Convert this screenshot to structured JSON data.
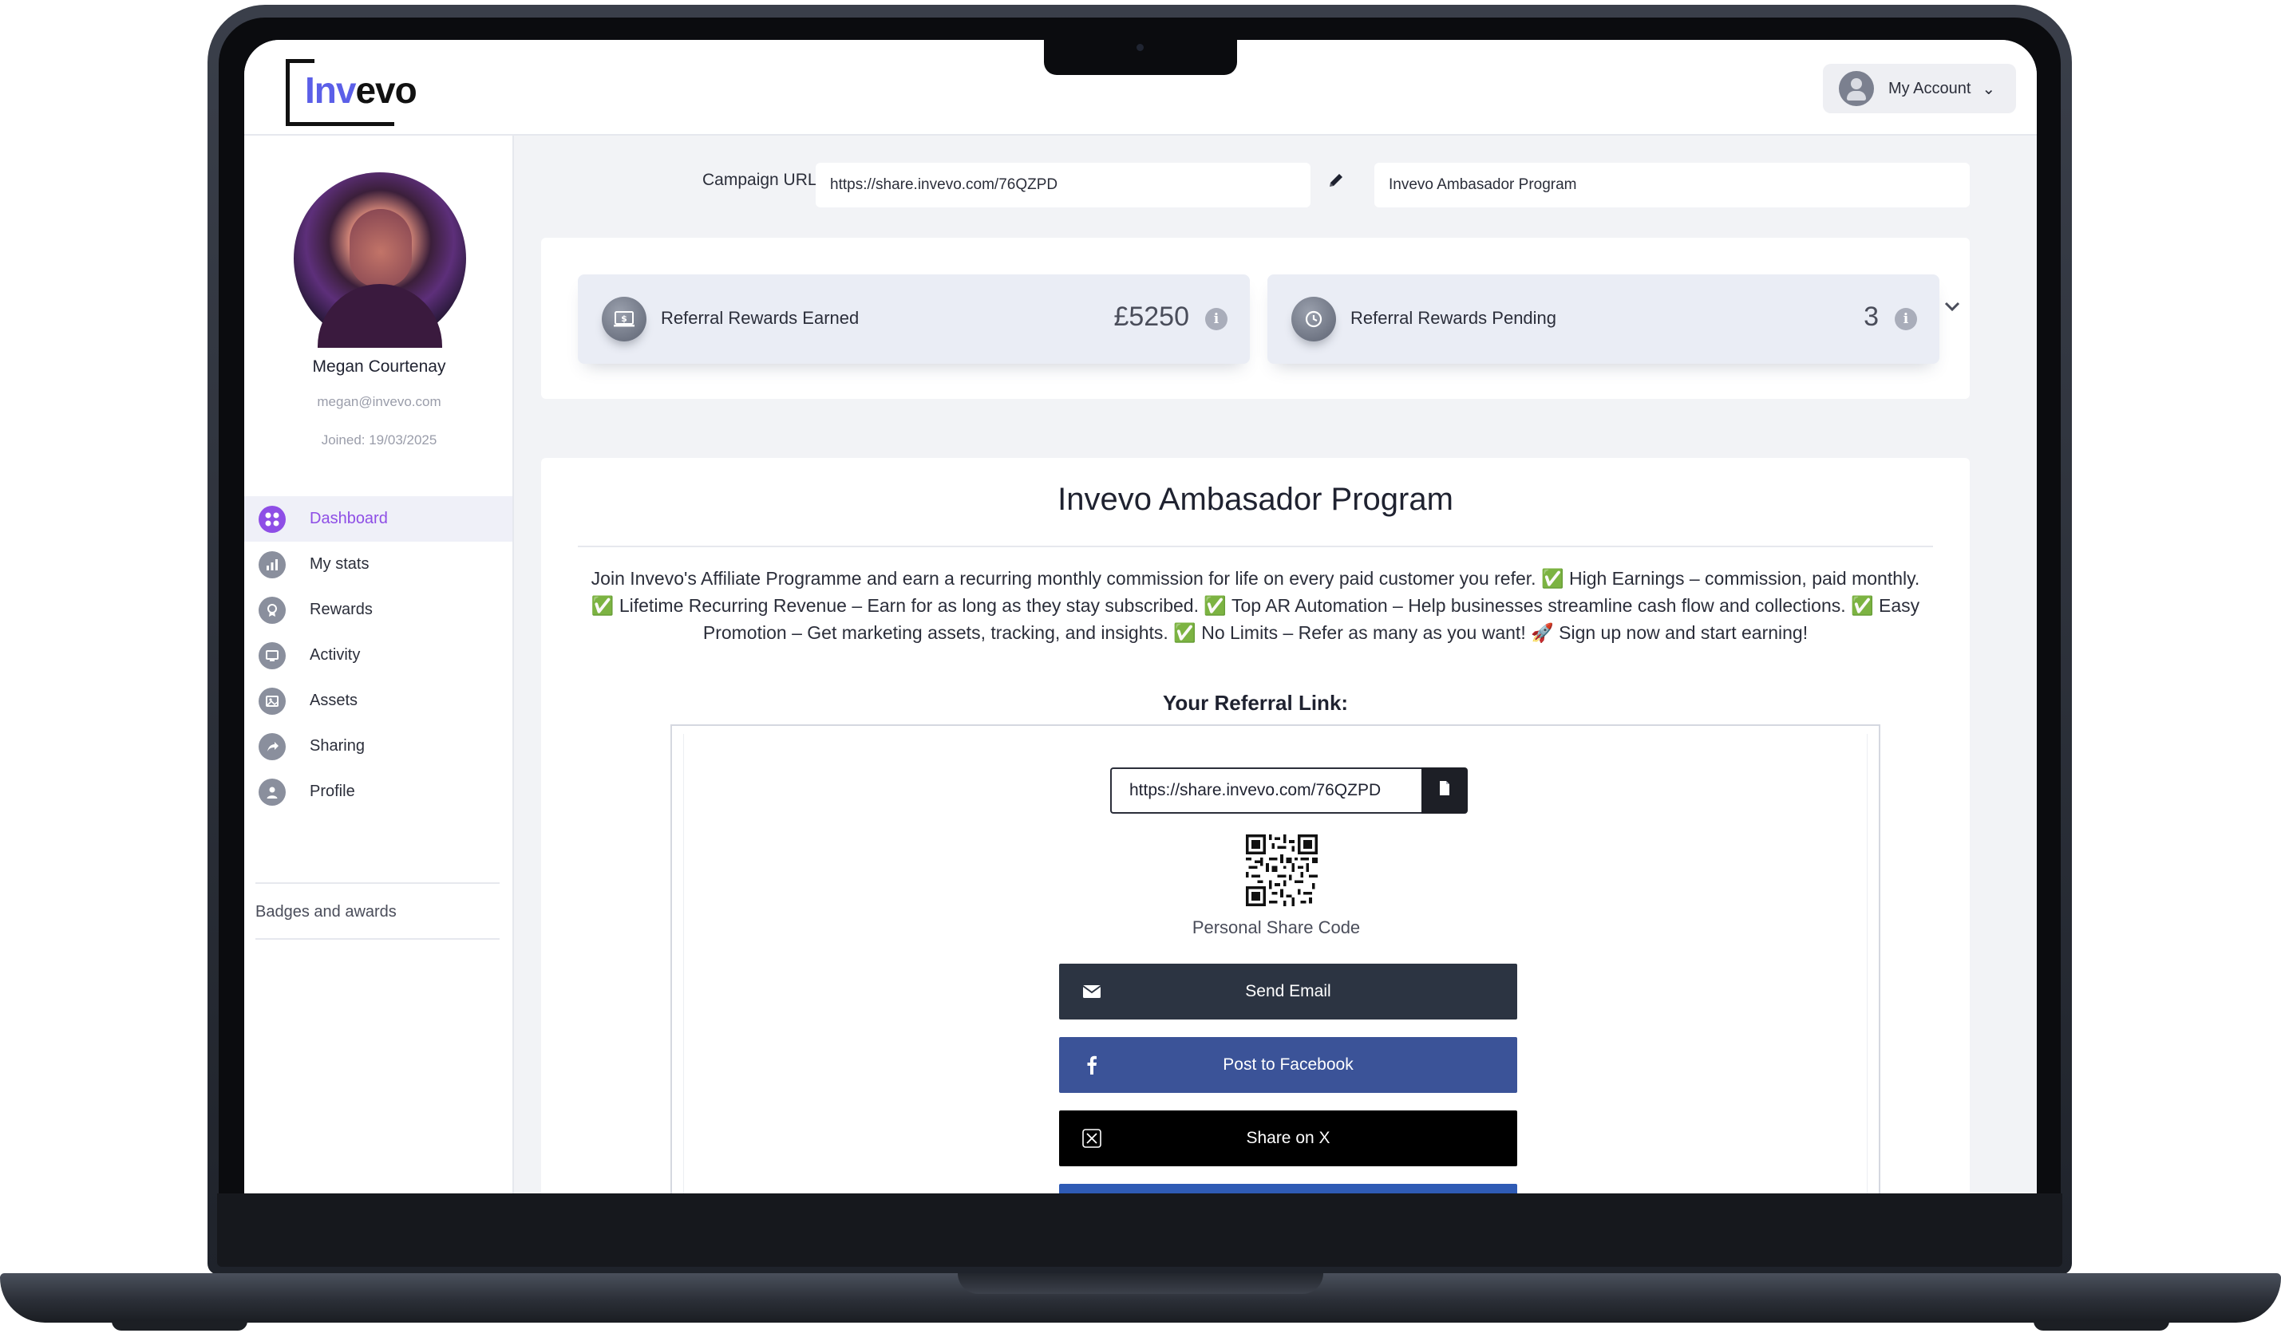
{
  "app": {
    "logo_text_accent": "Inv",
    "logo_text_rest": "evo",
    "account_label": "My Account"
  },
  "profile": {
    "name": "Megan Courtenay",
    "email": "megan@invevo.com",
    "joined": "Joined: 19/03/2025"
  },
  "nav": {
    "items": [
      {
        "label": "Dashboard",
        "icon": "grid-icon",
        "active": true
      },
      {
        "label": "My stats",
        "icon": "chart-icon",
        "active": false
      },
      {
        "label": "Rewards",
        "icon": "award-icon",
        "active": false
      },
      {
        "label": "Activity",
        "icon": "monitor-icon",
        "active": false
      },
      {
        "label": "Assets",
        "icon": "image-icon",
        "active": false
      },
      {
        "label": "Sharing",
        "icon": "share-icon",
        "active": false
      },
      {
        "label": "Profile",
        "icon": "user-icon",
        "active": false
      }
    ],
    "badges_label": "Badges and awards"
  },
  "campaign": {
    "url_label": "Campaign URL",
    "url_value": "https://share.invevo.com/76QZPD",
    "name_value": "Invevo Ambasador Program"
  },
  "stats": {
    "earned_label": "Referral Rewards Earned",
    "earned_value": "£5250",
    "pending_label": "Referral Rewards Pending",
    "pending_value": "3"
  },
  "program": {
    "title": "Invevo Ambasador Program",
    "description": "Join Invevo's Affiliate Programme and earn a recurring monthly commission for life on every paid customer you refer. ✅ High Earnings – commission, paid monthly. ✅ Lifetime Recurring Revenue – Earn for as long as they stay subscribed. ✅ Top AR Automation – Help businesses streamline cash flow and collections. ✅ Easy Promotion – Get marketing assets, tracking, and insights. ✅ No Limits – Refer as many as you want! 🚀 Sign up now and start earning!",
    "referral_title": "Your Referral Link:",
    "referral_link": "https://share.invevo.com/76QZPD",
    "qr_label": "Personal Share Code",
    "buttons": {
      "email": "Send Email",
      "facebook": "Post to Facebook",
      "x": "Share on X"
    }
  },
  "colors": {
    "accent": "#8e4ee6",
    "logo_blue": "#5b5fe8",
    "email_btn": "#2c3442",
    "facebook_btn": "#3b5398",
    "x_btn": "#000000"
  }
}
